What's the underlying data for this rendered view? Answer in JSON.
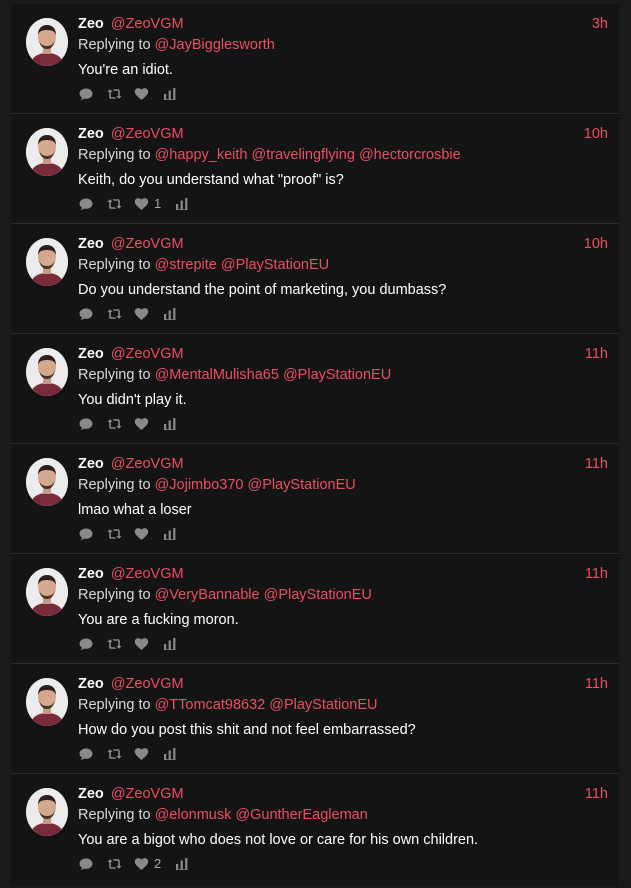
{
  "colors": {
    "accent": "#ea4f62",
    "background": "#141414",
    "text": "#ffffff",
    "muted": "#8a8a8a"
  },
  "tweets": [
    {
      "name": "Zeo",
      "handle": "@ZeoVGM",
      "time": "3h",
      "replying_prefix": "Replying to",
      "mentions": [
        "@JayBigglesworth"
      ],
      "text": "You're an idiot.",
      "likes": ""
    },
    {
      "name": "Zeo",
      "handle": "@ZeoVGM",
      "time": "10h",
      "replying_prefix": "Replying to",
      "mentions": [
        "@happy_keith",
        "@travelingflying",
        "@hectorcrosbie"
      ],
      "text": "Keith, do you understand what \"proof\" is?",
      "likes": "1"
    },
    {
      "name": "Zeo",
      "handle": "@ZeoVGM",
      "time": "10h",
      "replying_prefix": "Replying to",
      "mentions": [
        "@strepite",
        "@PlayStationEU"
      ],
      "text": "Do you understand the point of marketing, you dumbass?",
      "likes": ""
    },
    {
      "name": "Zeo",
      "handle": "@ZeoVGM",
      "time": "11h",
      "replying_prefix": "Replying to",
      "mentions": [
        "@MentalMulisha65",
        "@PlayStationEU"
      ],
      "text": "You didn't play it.",
      "likes": ""
    },
    {
      "name": "Zeo",
      "handle": "@ZeoVGM",
      "time": "11h",
      "replying_prefix": "Replying to",
      "mentions": [
        "@Jojimbo370",
        "@PlayStationEU"
      ],
      "text": "lmao what a loser",
      "likes": ""
    },
    {
      "name": "Zeo",
      "handle": "@ZeoVGM",
      "time": "11h",
      "replying_prefix": "Replying to",
      "mentions": [
        "@VeryBannable",
        "@PlayStationEU"
      ],
      "text": "You are a fucking moron.",
      "likes": ""
    },
    {
      "name": "Zeo",
      "handle": "@ZeoVGM",
      "time": "11h",
      "replying_prefix": "Replying to",
      "mentions": [
        "@TTomcat98632",
        "@PlayStationEU"
      ],
      "text": "How do you post this shit and not feel embarrassed?",
      "likes": ""
    },
    {
      "name": "Zeo",
      "handle": "@ZeoVGM",
      "time": "11h",
      "replying_prefix": "Replying to",
      "mentions": [
        "@elonmusk",
        "@GuntherEagleman"
      ],
      "text": "You are a bigot who does not love or care for his own children.",
      "likes": "2"
    }
  ]
}
